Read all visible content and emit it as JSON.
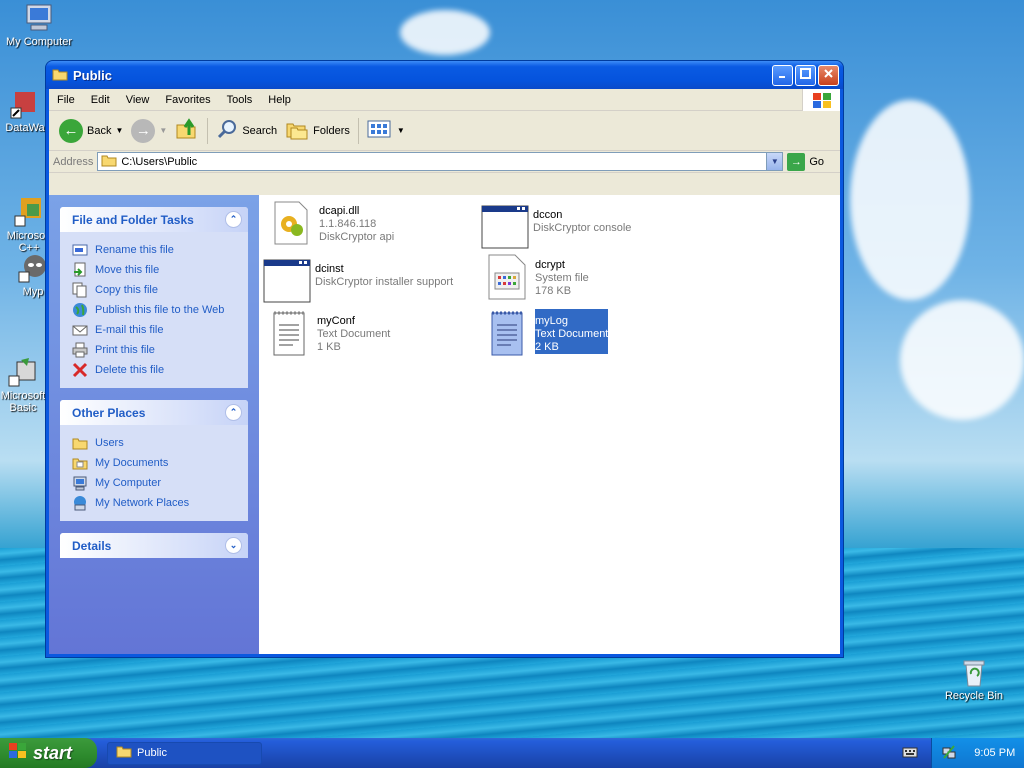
{
  "desktop": {
    "icons": [
      {
        "label": "My Computer"
      },
      {
        "label": "DataWa"
      },
      {
        "label": "Microsoft\nC++"
      },
      {
        "label": "Myp"
      },
      {
        "label": "Microsoft\nBasic"
      },
      {
        "label": "Recycle Bin"
      }
    ]
  },
  "window": {
    "title": "Public",
    "menu": [
      "File",
      "Edit",
      "View",
      "Favorites",
      "Tools",
      "Help"
    ],
    "toolbar": {
      "back_label": "Back",
      "search_label": "Search",
      "folders_label": "Folders"
    },
    "address": {
      "label": "Address",
      "value": "C:\\Users\\Public",
      "go_label": "Go"
    },
    "side_panels": {
      "file_tasks": {
        "title": "File and Folder Tasks",
        "items": [
          "Rename this file",
          "Move this file",
          "Copy this file",
          "Publish this file to the Web",
          "E-mail this file",
          "Print this file",
          "Delete this file"
        ]
      },
      "other_places": {
        "title": "Other Places",
        "items": [
          "Users",
          "My Documents",
          "My Computer",
          "My Network Places"
        ]
      },
      "details": {
        "title": "Details"
      }
    },
    "files": [
      {
        "name": "dcapi.dll",
        "line2": "1.1.846.118",
        "line3": "DiskCryptor api"
      },
      {
        "name": "dccon",
        "line2": "DiskCryptor console",
        "line3": ""
      },
      {
        "name": "dcinst",
        "line2": "DiskCryptor installer support",
        "line3": ""
      },
      {
        "name": "dcrypt",
        "line2": "System file",
        "line3": "178 KB"
      },
      {
        "name": "myConf",
        "line2": "Text Document",
        "line3": "1 KB"
      },
      {
        "name": "myLog",
        "line2": "Text Document",
        "line3": "2 KB"
      }
    ]
  },
  "taskbar": {
    "start_label": "start",
    "task_label": "Public",
    "clock": "9:05 PM"
  },
  "colors": {
    "xp_blue": "#0a58e0",
    "link_blue": "#215dc6",
    "selection": "#316ac5"
  }
}
